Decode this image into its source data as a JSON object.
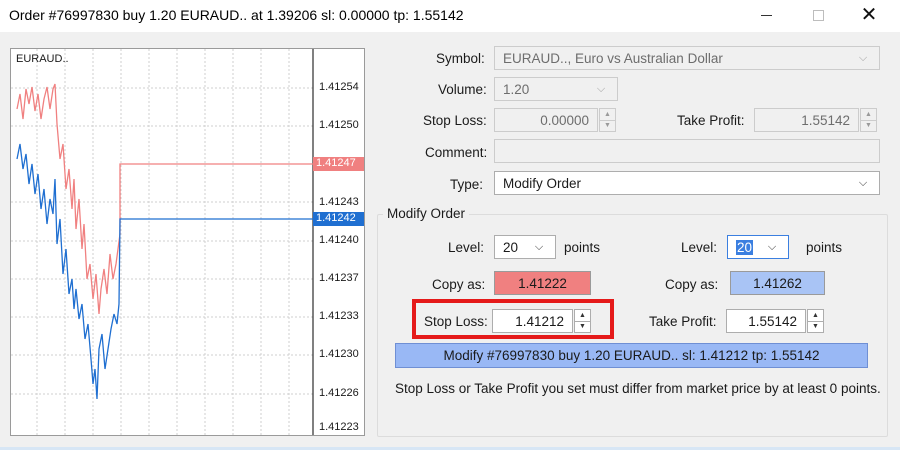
{
  "window": {
    "title": "Order #76997830 buy 1.20 EURAUD.. at 1.39206 sl: 0.00000 tp: 1.55142",
    "minimize_glyph": "",
    "maximize_glyph": "",
    "close_glyph": "✕"
  },
  "chart": {
    "symbol_label": "EURAUD..",
    "price_labels": [
      "1.41254",
      "1.41250",
      "1.41247",
      "1.41243",
      "1.41242",
      "1.41240",
      "1.41237",
      "1.41233",
      "1.41230",
      "1.41226",
      "1.41223"
    ],
    "ask_price": "1.41247",
    "bid_price": "1.41242",
    "ask_color": "#f08080",
    "bid_color": "#1f6fd1"
  },
  "form": {
    "symbol_label": "Symbol:",
    "symbol_value": "EURAUD.., Euro vs Australian Dollar",
    "volume_label": "Volume:",
    "volume_value": "1.20",
    "stop_loss_label": "Stop Loss:",
    "stop_loss_value": "0.00000",
    "take_profit_label": "Take Profit:",
    "take_profit_value": "1.55142",
    "comment_label": "Comment:",
    "comment_value": "",
    "type_label": "Type:",
    "type_value": "Modify Order"
  },
  "modify_order": {
    "group_title": "Modify Order",
    "left": {
      "level_label": "Level:",
      "level_value": "20",
      "points_label": "points",
      "copy_label": "Copy as:",
      "copy_value": "1.41222",
      "stop_loss_label": "Stop Loss:",
      "stop_loss_value": "1.41212"
    },
    "right": {
      "level_label": "Level:",
      "level_value": "20",
      "points_label": "points",
      "copy_label": "Copy as:",
      "copy_value": "1.41262",
      "take_profit_label": "Take Profit:",
      "take_profit_value": "1.55142"
    },
    "modify_button": "Modify #76997830 buy 1.20 EURAUD.. sl: 1.41212 tp: 1.55142",
    "info_text": "Stop Loss or Take Profit you set must differ from market price by at least 0 points."
  },
  "icons": {
    "dropdown": "chevron-down-icon",
    "spin_up": "arrow-up-icon",
    "spin_down": "arrow-down-icon"
  }
}
